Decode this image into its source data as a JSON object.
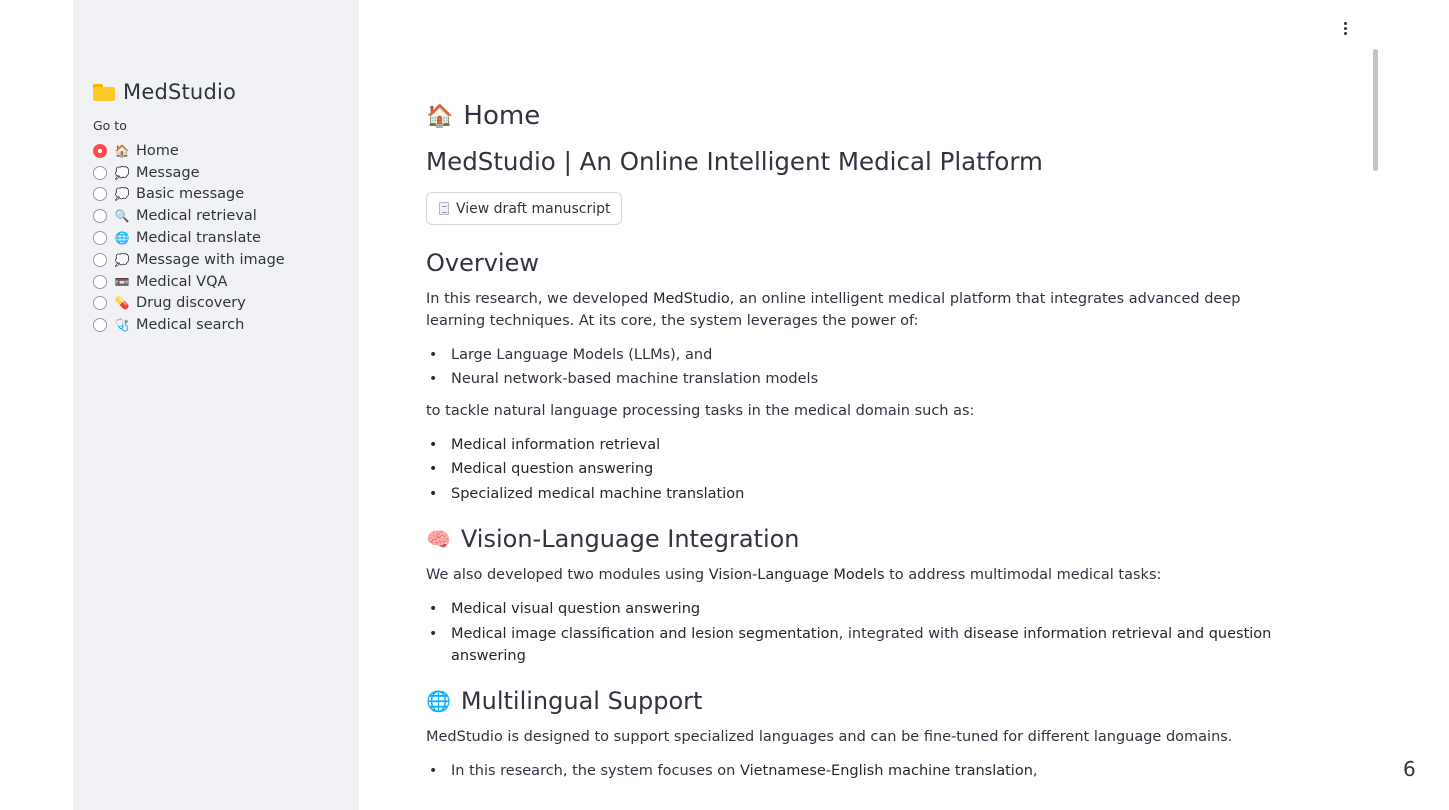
{
  "sidebar": {
    "title": "MedStudio",
    "goto_label": "Go to",
    "items": [
      {
        "emoji": "🏠",
        "icon": "house-icon",
        "label": "Home",
        "selected": true
      },
      {
        "emoji": "💭",
        "icon": "thought-bubble-icon",
        "label": "Message",
        "selected": false
      },
      {
        "emoji": "💭",
        "icon": "thought-bubble-icon",
        "label": "Basic message",
        "selected": false
      },
      {
        "emoji": "🔍",
        "icon": "magnifier-icon",
        "label": "Medical retrieval",
        "selected": false
      },
      {
        "emoji": "🌐",
        "icon": "globe-icon",
        "label": "Medical translate",
        "selected": false
      },
      {
        "emoji": "💭",
        "icon": "thought-bubble-icon",
        "label": "Message with image",
        "selected": false
      },
      {
        "emoji": "📼",
        "icon": "cassette-icon",
        "label": "Medical VQA",
        "selected": false
      },
      {
        "emoji": "💊",
        "icon": "pill-icon",
        "label": "Drug discovery",
        "selected": false
      },
      {
        "emoji": "🩺",
        "icon": "stethoscope-icon",
        "label": "Medical search",
        "selected": false
      }
    ]
  },
  "main": {
    "home_emoji": "🏠",
    "home_title": "Home",
    "subtitle": "MedStudio | An Online Intelligent Medical Platform",
    "draft_button": "View draft manuscript",
    "overview": {
      "heading": "Overview",
      "intro_pre": "In this research, we developed ",
      "intro_strong": "MedStudio",
      "intro_post": ", an online intelligent medical platform that integrates advanced deep learning techniques. At its core, the system leverages the power of:",
      "tech_items": [
        "Large Language Models (LLMs), and",
        "Neural network-based machine translation models"
      ],
      "tasks_intro": "to tackle natural language processing tasks in the medical domain such as:",
      "task_items": [
        "Medical information retrieval",
        "Medical question answering",
        "Specialized medical machine translation"
      ]
    },
    "vision": {
      "emoji": "🧠",
      "heading": "Vision-Language Integration",
      "intro_pre": "We also developed two modules using ",
      "intro_strong": "Vision-Language Models",
      "intro_post": " to address multimodal medical tasks:",
      "item1": "Medical visual question answering",
      "item2_strong_a": "Medical image classification and lesion segmentation",
      "item2_mid": ", integrated with ",
      "item2_strong_b": "disease information retrieval and question answering"
    },
    "multilingual": {
      "emoji": "🌐",
      "heading": "Multilingual Support",
      "intro": "MedStudio is designed to support specialized languages and can be fine-tuned for different language domains.",
      "item1_pre": "In this research, the system focuses on ",
      "item1_strong": "Vietnamese-English machine translation",
      "item1_post": ","
    }
  },
  "page_number": "6"
}
